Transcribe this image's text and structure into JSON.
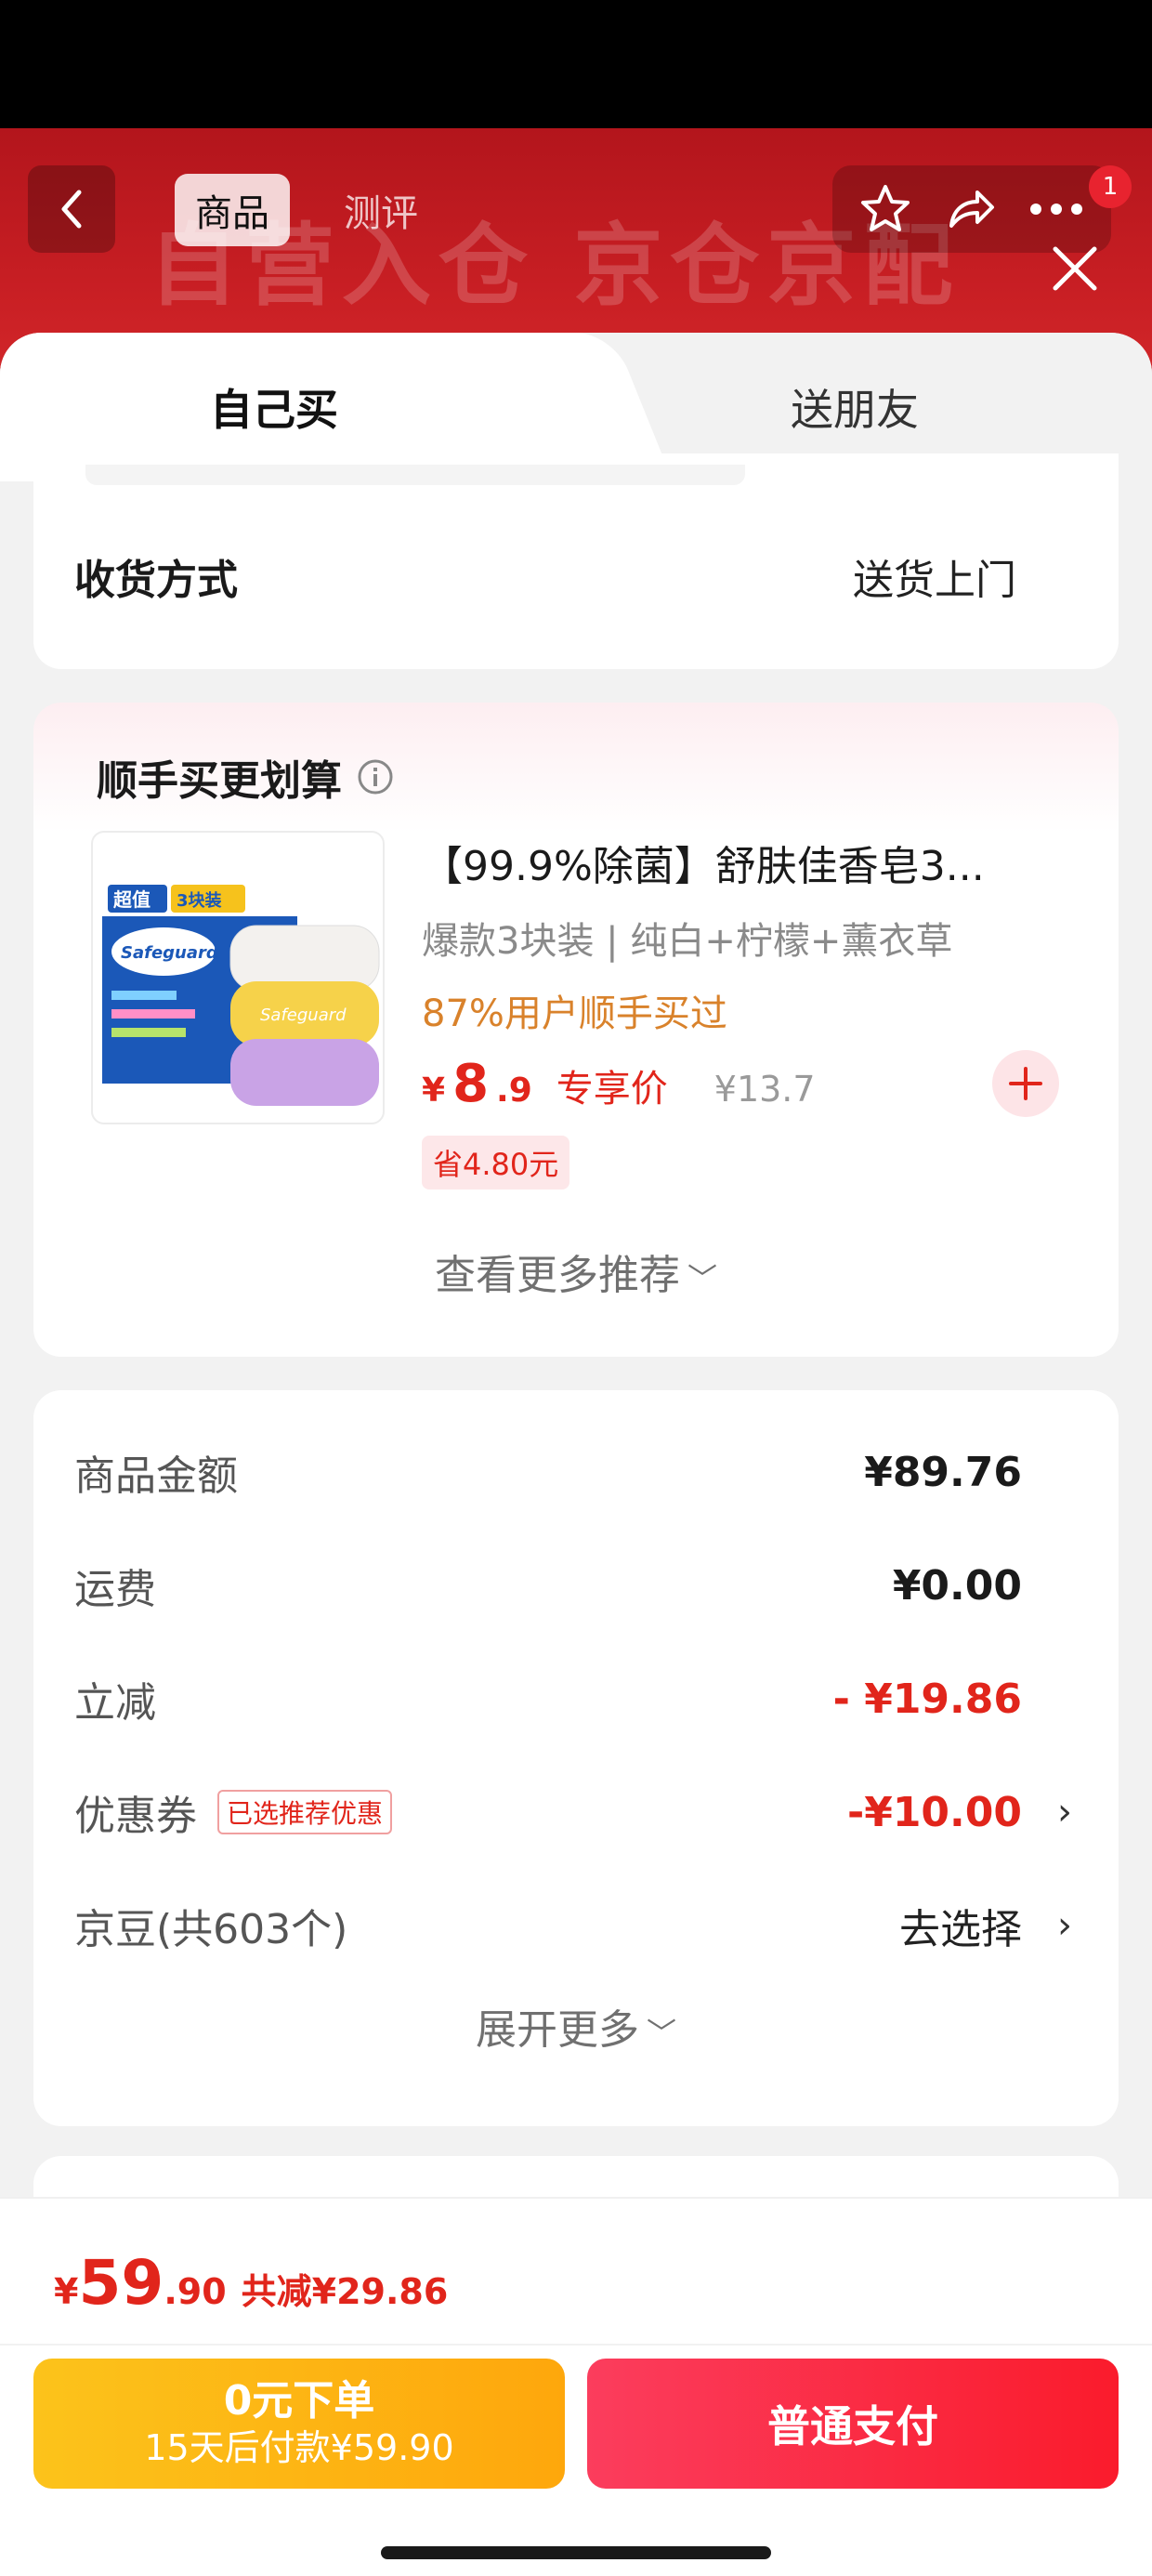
{
  "header": {
    "banner_text": "自营入仓 京仓京配",
    "tabs": [
      "商品",
      "测评"
    ],
    "notification_count": "1"
  },
  "sheet_tabs": {
    "self": "自己买",
    "gift": "送朋友"
  },
  "shipping": {
    "label": "收货方式",
    "value": "送货上门"
  },
  "recommend": {
    "title": "顺手买更划算",
    "product": {
      "name": "【99.9%除菌】舒肤佳香皂3...",
      "spec": "爆款3块装 | 纯白+柠檬+薰衣草",
      "social": "87%用户顺手买过",
      "price_currency": "¥",
      "price_int": "8",
      "price_dec": ".9",
      "price_tag": "专享价",
      "original_price": "¥13.7",
      "save": "省4.80元",
      "image_text": {
        "badge": "超值",
        "badge_count": "3块装",
        "brand": "Safeguard",
        "bar": "Safeguard"
      }
    },
    "more": "查看更多推荐"
  },
  "fees": {
    "rows": [
      {
        "label": "商品金额",
        "value": "¥89.76"
      },
      {
        "label": "运费",
        "value": "¥0.00"
      },
      {
        "label": "立减",
        "value": "- ¥19.86"
      },
      {
        "label": "优惠券",
        "badge": "已选推荐优惠",
        "value": "-¥10.00"
      },
      {
        "label": "京豆(共603个)",
        "value": "去选择"
      }
    ],
    "expand": "展开更多"
  },
  "bottom": {
    "currency": "¥",
    "total_int": "59",
    "total_dec": ".90",
    "total_save": "共减¥29.86",
    "zero_pay_title": "0元下单",
    "zero_pay_sub": "15天后付款¥59.90",
    "pay_label": "普通支付"
  },
  "colors": {
    "accent_red": "#e1251b",
    "pay_button": "#fa1b2c",
    "zero_button": "#fcc31b",
    "social_orange": "#d9822b"
  }
}
